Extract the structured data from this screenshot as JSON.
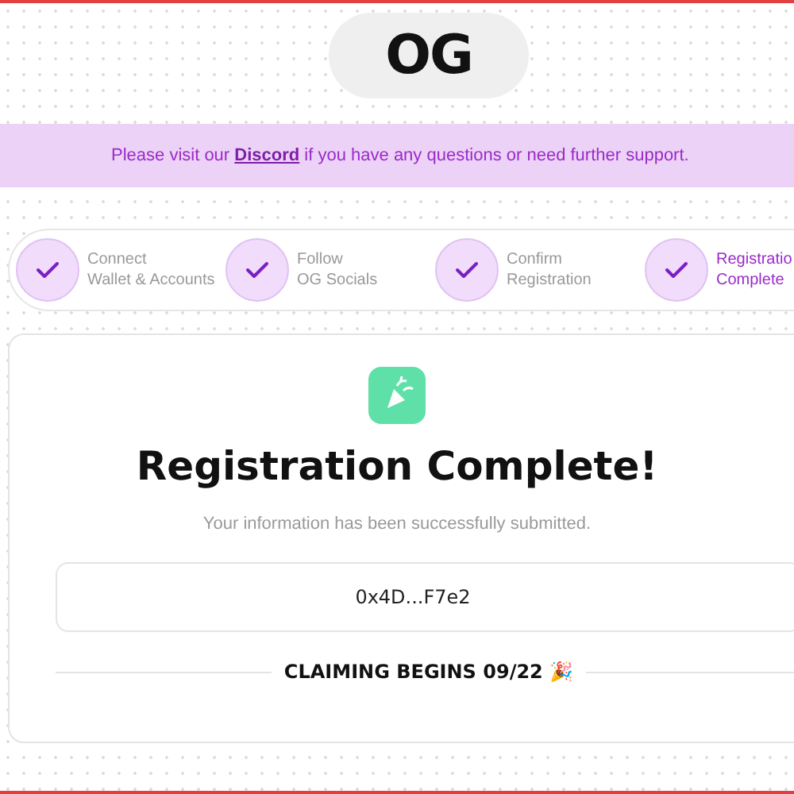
{
  "logo": {
    "text": "OG"
  },
  "notice": {
    "before": "Please visit our ",
    "link": "Discord",
    "after": " if you have any questions or need further support."
  },
  "steps": [
    {
      "line1": "Connect",
      "line2": "Wallet & Accounts",
      "done": true,
      "selected": false
    },
    {
      "line1": "Follow",
      "line2": "OG Socials",
      "done": true,
      "selected": false
    },
    {
      "line1": "Confirm",
      "line2": "Registration",
      "done": true,
      "selected": false
    },
    {
      "line1": "Registratio",
      "line2": "Complete",
      "done": true,
      "selected": true
    }
  ],
  "card": {
    "title": "Registration Complete!",
    "subtitle": "Your information has been successfully submitted.",
    "address": "0x4D...F7e2",
    "claim": "CLAIMING BEGINS 09/22 🎉"
  }
}
